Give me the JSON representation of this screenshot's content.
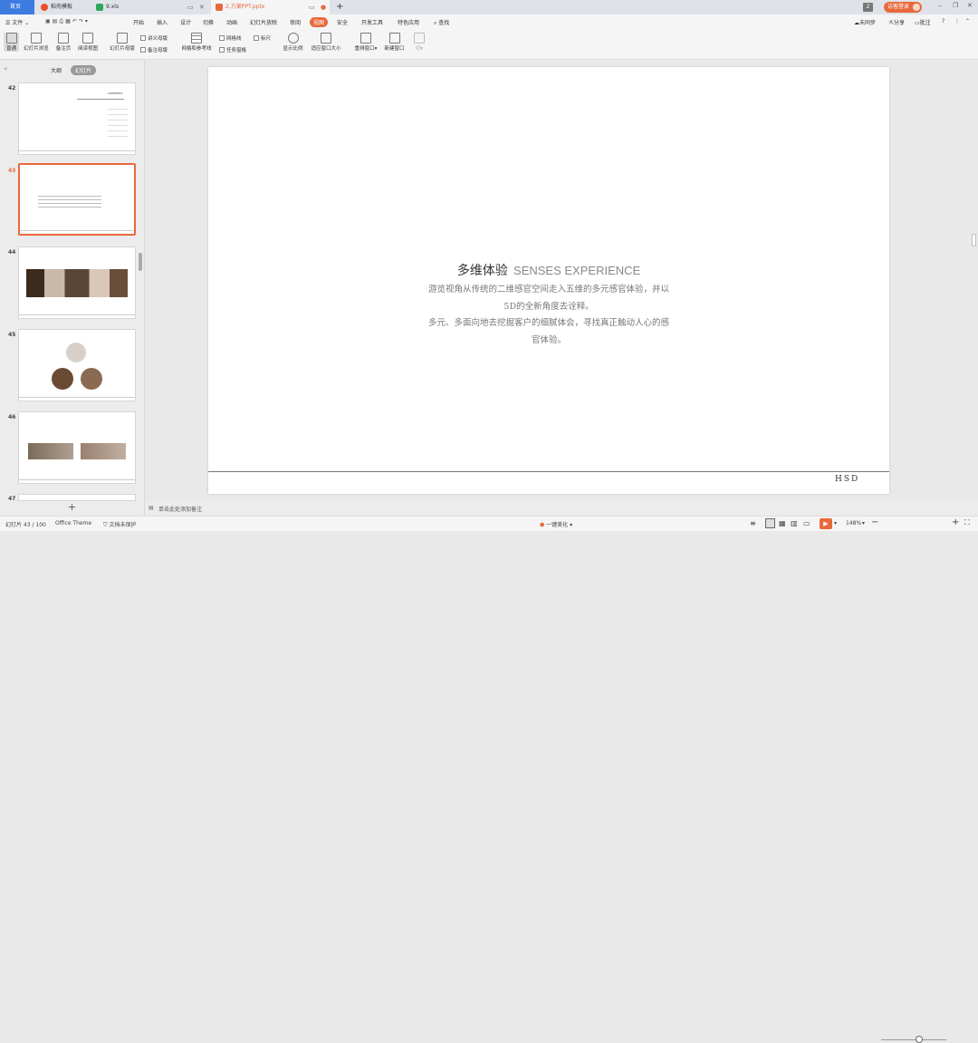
{
  "tabs": {
    "home": "首页",
    "docer": "稻壳模板",
    "xls": "9.xls",
    "ppt": "2.方案PPT.pptx",
    "add": "+"
  },
  "titlebar_right": {
    "badge": "2",
    "login": "访客登录"
  },
  "menu": {
    "file": "文件",
    "items": [
      "开始",
      "插入",
      "设计",
      "切换",
      "动画",
      "幻灯片放映",
      "审阅",
      "视图",
      "安全",
      "开发工具",
      "特色应用"
    ],
    "active_index": 7,
    "search": "查找",
    "sync": "未同步",
    "share": "分享",
    "comment": "批注"
  },
  "ribbon": {
    "normal": "普通",
    "slide_sorter": "幻灯片浏览",
    "notes_page": "备注页",
    "reading_view": "阅读视图",
    "slide_master": "幻灯片母版",
    "handout_master": "讲义母版",
    "notes_master": "备注母版",
    "grid": "网格和参考线",
    "gridlines": "网格线",
    "ruler": "标尺",
    "task_pane": "任务窗格",
    "zoom": "显示比例",
    "fit_window": "适应窗口大小",
    "rearrange": "重排窗口",
    "new_window": "新建窗口",
    "more": "切"
  },
  "panel": {
    "outline": "大纲",
    "slides": "幻灯片",
    "add": "+",
    "slide_numbers": [
      "42",
      "43",
      "44",
      "45",
      "46",
      "47"
    ],
    "selected": "43",
    "thumb42_title": "CONTENTS"
  },
  "slide": {
    "title_cn": "多维体验",
    "title_en": "SENSES EXPERIENCE",
    "line1": "游览视角从传统的二维感官空间走入五维的多元感官体验，并以",
    "line2": "5D的全新角度去诠释。",
    "line3": "多元、多面向地去挖掘客户的细腻体会，寻找真正触动人心的感",
    "line4": "官体验。",
    "logo": "HSD"
  },
  "notes": {
    "placeholder": "单击此处添加备注"
  },
  "status": {
    "slide_index": "幻灯片 43 / 100",
    "theme": "Office Theme",
    "protect": "文档未保护",
    "beautify": "一键美化",
    "zoom": "148%"
  },
  "colors": {
    "accent": "#e9693c",
    "home_tab": "#3d7be0"
  }
}
